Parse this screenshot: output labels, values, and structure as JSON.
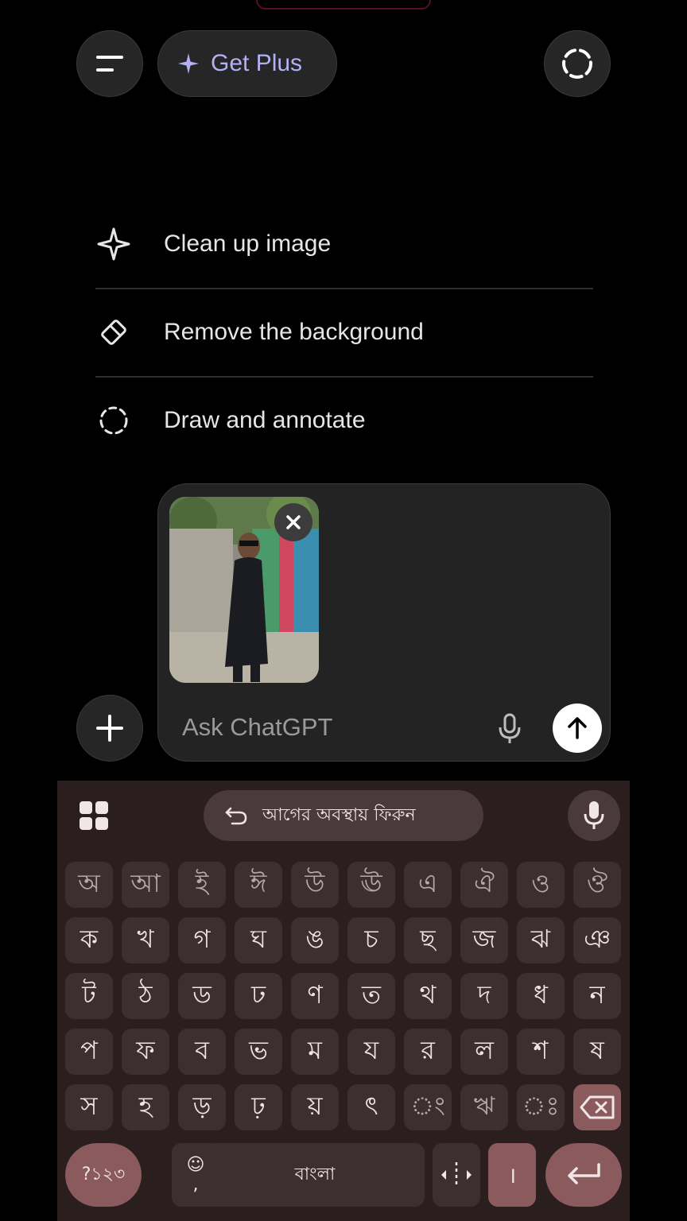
{
  "top": {
    "menu_icon": "menu-icon",
    "get_plus_label": "Get Plus",
    "temp_chat_icon": "dashed-circle-icon"
  },
  "suggestions": [
    {
      "label": "Clean up image",
      "icon": "sparkle-icon"
    },
    {
      "label": "Remove the background",
      "icon": "eraser-icon"
    },
    {
      "label": "Draw and annotate",
      "icon": "dashed-circle-icon"
    }
  ],
  "composer": {
    "attachment_alt": "attached photo",
    "placeholder": "Ask ChatGPT",
    "send_icon": "arrow-up-icon",
    "mic_icon": "mic-icon",
    "plus_icon": "plus-icon"
  },
  "keyboard": {
    "suggestion_text": "আগের অবস্থায় ফিরুন",
    "rows": [
      [
        "অ",
        "আ",
        "ই",
        "ঈ",
        "উ",
        "ঊ",
        "এ",
        "ঐ",
        "ও",
        "ঔ"
      ],
      [
        "ক",
        "খ",
        "গ",
        "ঘ",
        "ঙ",
        "চ",
        "ছ",
        "জ",
        "ঝ",
        "ঞ"
      ],
      [
        "ট",
        "ঠ",
        "ড",
        "ঢ",
        "ণ",
        "ত",
        "থ",
        "দ",
        "ধ",
        "ন"
      ],
      [
        "প",
        "ফ",
        "ব",
        "ভ",
        "ম",
        "য",
        "র",
        "ল",
        "শ",
        "ষ"
      ],
      [
        "স",
        "হ",
        "ড়",
        "ঢ়",
        "য়",
        "ৎ",
        "ং",
        "ঋ",
        "ঃ"
      ]
    ],
    "symbols_label": "?১২৩",
    "emoji_label": "☺",
    "comma_label": ",",
    "space_label": "বাংলা",
    "danda_label": "।",
    "enter_icon": "enter-icon",
    "backspace_icon": "backspace-icon"
  }
}
